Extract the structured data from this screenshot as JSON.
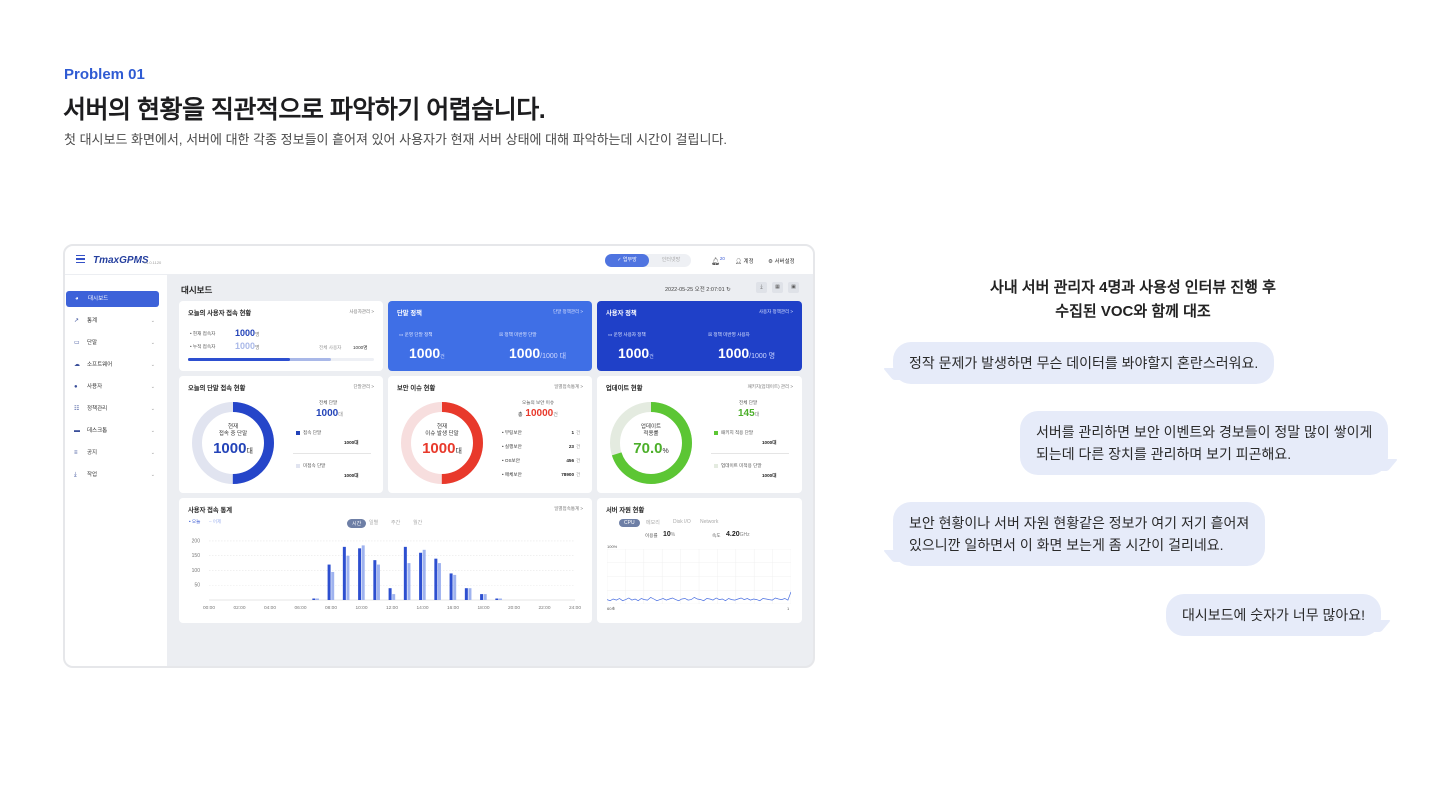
{
  "intro": {
    "kicker": "Problem 01",
    "headline": "서버의 현황을 직관적으로 파악하기 어렵습니다.",
    "subline": "첫 대시보드 화면에서, 서버에 대한 각종 정보들이 흩어져 있어 사용자가 현재 서버 상태에 대해 파악하는데 시간이 걸립니다."
  },
  "app": {
    "logo": "TmaxGPMS",
    "version": "v1.0.1120",
    "mode_on": "✓ 업무망",
    "mode_off": "인터넷망",
    "notif_count": "20",
    "account": "계정",
    "settings": "서버설정",
    "settings_icon": "gear-icon"
  },
  "sidebar": {
    "items": [
      {
        "label": "대시보드",
        "icon": "dashboard-icon",
        "glyph": "◕"
      },
      {
        "label": "통계",
        "icon": "trend-icon",
        "glyph": "↗"
      },
      {
        "label": "단말",
        "icon": "laptop-icon",
        "glyph": "▭"
      },
      {
        "label": "소프트웨어",
        "icon": "cloud-icon",
        "glyph": "☁"
      },
      {
        "label": "사용자",
        "icon": "user-icon",
        "glyph": "●"
      },
      {
        "label": "정책관리",
        "icon": "list-icon",
        "glyph": "☷"
      },
      {
        "label": "데스크톱",
        "icon": "monitor-icon",
        "glyph": "▬"
      },
      {
        "label": "공지",
        "icon": "menu-icon",
        "glyph": "≡"
      },
      {
        "label": "작업",
        "icon": "download-icon",
        "glyph": "⤓"
      }
    ]
  },
  "main": {
    "title": "대시보드",
    "datetime": "2022-05-25 오전 2:07:01 ↻"
  },
  "user_access": {
    "title": "오늘의 사용자 접속 현황",
    "link": "사용자관리 >",
    "current_label": "• 현재 접속자",
    "current_value": "1000",
    "current_unit": "명",
    "total_label": "• 누적 접속자",
    "total_value": "1000",
    "total_unit": "명",
    "all_label": "전체 사용자",
    "all_value": "1000",
    "all_unit": "명",
    "bar1_fraction": 0.55,
    "bar2_fraction": 0.77
  },
  "device_policy": {
    "title": "단말 정책",
    "link": "단말 정책관리 >",
    "left_label": "운영 단말 정책",
    "left_value": "1000",
    "left_unit": "건",
    "right_label": "정책 미반영 단말",
    "right_value": "1000",
    "right_unit": "/1000 대"
  },
  "user_policy": {
    "title": "사용자 정책",
    "link": "사용자 정책관리 >",
    "left_label": "운영 사용자 정책",
    "left_value": "1000",
    "left_unit": "건",
    "right_label": "정책 미반영 사용자",
    "right_value": "1000",
    "right_unit": "/1000 명"
  },
  "device_access": {
    "title": "오늘의 단말 접속 현황",
    "link": "단말관리 >",
    "donut_label1": "현재",
    "donut_label2": "접속 중 단말",
    "donut_value": "1000",
    "donut_unit": "대",
    "total_label": "전체 단말",
    "total_value": "1000",
    "total_unit": "대",
    "connected_label": "접속 단말",
    "connected_value": "1000",
    "connected_unit": "대",
    "disconnected_label": "미접속 단말",
    "disconnected_value": "1000",
    "disconnected_unit": "대",
    "ring_fraction": 0.5,
    "ring_color": "#2545c9"
  },
  "security": {
    "title": "보안 이슈 현황",
    "link": "일별접속통계 >",
    "donut_label1": "현재",
    "donut_label2": "이슈 발생 단말",
    "donut_value": "1000",
    "donut_unit": "대",
    "today_label": "오늘의 보안 이슈",
    "today_prefix": "총",
    "today_value": "10000",
    "today_unit": "건",
    "items": [
      {
        "label": "부팅보안",
        "value": "1",
        "unit": "건"
      },
      {
        "label": "실행보안",
        "value": "23",
        "unit": "건"
      },
      {
        "label": "OS보안",
        "value": "456",
        "unit": "건"
      },
      {
        "label": "매체보안",
        "value": "78900",
        "unit": "건"
      }
    ],
    "ring_fraction": 0.5,
    "ring_color": "#e8392b"
  },
  "update": {
    "title": "업데이트 현황",
    "link": "패키지(업데이트) 관리 >",
    "donut_label1": "업데이트",
    "donut_label2": "적용률",
    "donut_value": "70.0",
    "donut_unit": "%",
    "total_label": "전체 단말",
    "total_value": "145",
    "total_unit": "대",
    "applied_label": "패키지 적용 단말",
    "applied_value": "1000",
    "applied_unit": "대",
    "not_applied_label": "업데이트 미적용 단말",
    "not_applied_value": "1000",
    "not_applied_unit": "대",
    "ring_fraction": 0.7,
    "ring_color": "#5cc634"
  },
  "access_stats": {
    "title": "사용자 접속 통계",
    "link": "일별접속통계 >",
    "legend_today": "• 오늘",
    "legend_yesterday": "– 어제",
    "tabs": [
      "시간",
      "일별",
      "주간",
      "월간"
    ],
    "tab_selected": 0
  },
  "resources": {
    "title": "서버 자원 현황",
    "tabs": [
      "CPU",
      "메모리",
      "Disk I/O",
      "Network"
    ],
    "tab_selected": 0,
    "usage_label": "이용률",
    "usage_value": "10",
    "usage_unit": "%",
    "speed_label": "속도",
    "speed_value": "4.20",
    "speed_unit": "GHz",
    "y_top": "100%",
    "x_left": "60초",
    "x_right": "1"
  },
  "chart_data": [
    {
      "type": "bar",
      "categories": [
        "00:00",
        "01:00",
        "02:00",
        "03:00",
        "04:00",
        "05:00",
        "06:00",
        "07:00",
        "08:00",
        "09:00",
        "10:00",
        "11:00",
        "12:00",
        "13:00",
        "14:00",
        "15:00",
        "16:00",
        "17:00",
        "18:00",
        "19:00",
        "20:00",
        "21:00",
        "22:00",
        "23:00",
        "24:00"
      ],
      "tick_labels": [
        "00:00",
        "02:00",
        "04:00",
        "06:00",
        "08:00",
        "10:00",
        "12:00",
        "14:00",
        "16:00",
        "18:00",
        "20:00",
        "22:00",
        "24:00"
      ],
      "series": [
        {
          "name": "오늘",
          "color": "#2d4fd0",
          "values": [
            0,
            0,
            0,
            0,
            0,
            0,
            0,
            5,
            120,
            180,
            175,
            135,
            40,
            180,
            160,
            140,
            90,
            40,
            20,
            5,
            0,
            0,
            0,
            0,
            0
          ]
        },
        {
          "name": "어제",
          "color": "#9fb3ef",
          "values": [
            0,
            0,
            0,
            0,
            0,
            0,
            0,
            5,
            95,
            150,
            185,
            120,
            20,
            125,
            170,
            125,
            85,
            40,
            20,
            5,
            0,
            0,
            0,
            0,
            0
          ]
        }
      ],
      "y_ticks": [
        50,
        100,
        150,
        200
      ],
      "ylim": [
        0,
        210
      ],
      "grid": true
    },
    {
      "type": "line",
      "series": [
        {
          "name": "CPU",
          "color": "#4a6fe0",
          "values": [
            8,
            6,
            9,
            7,
            10,
            6,
            8,
            11,
            7,
            9,
            6,
            10,
            8,
            7,
            12,
            9,
            6,
            8,
            10,
            7,
            9,
            11,
            8,
            6,
            9,
            10,
            7,
            8,
            12,
            9,
            8,
            6,
            10,
            9,
            7,
            11,
            8,
            9,
            6,
            10,
            8,
            7,
            9,
            11,
            8,
            10,
            7,
            9,
            8,
            6,
            10,
            9,
            8,
            7,
            11,
            9,
            8,
            10,
            7,
            22
          ]
        }
      ],
      "ylim": [
        0,
        100
      ],
      "grid": true
    }
  ],
  "voc": {
    "heading_line1": "사내 서버 관리자 4명과 사용성 인터뷰 진행 후",
    "heading_line2": "수집된 VOC와 함께 대조",
    "q1": "정작 문제가 발생하면 무슨 데이터를 봐야할지 혼란스러워요.",
    "q2_line1": "서버를 관리하면 보안 이벤트와 경보들이 정말 많이 쌓이게",
    "q2_line2": "되는데 다른 장치를 관리하며 보기 피곤해요.",
    "q3_line1": "보안 현황이나 서버 자원 현황같은 정보가 여기 저기 흩어져",
    "q3_line2": "있으니깐 일하면서 이 화면 보는게 좀 시간이 걸리네요.",
    "q4": "대시보드에 숫자가 너무 많아요!"
  }
}
